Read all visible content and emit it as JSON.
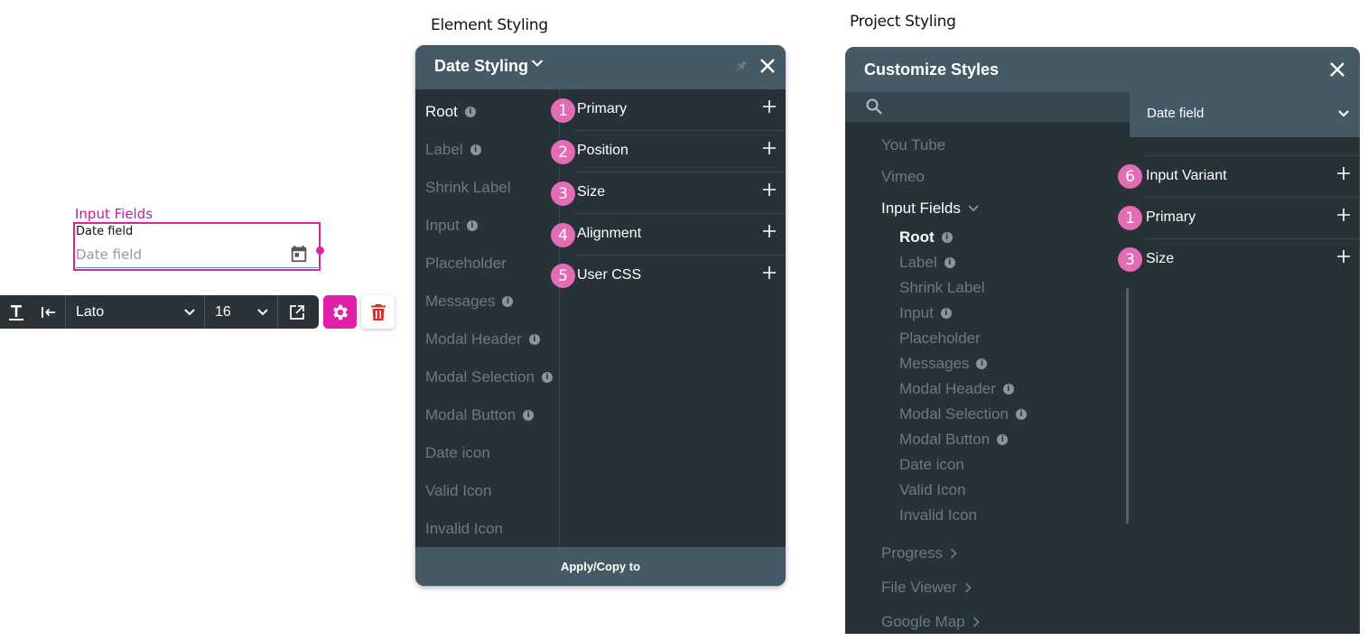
{
  "captions": {
    "element": "Element Styling",
    "project": "Project Styling"
  },
  "canvas": {
    "group_label": "Input Fields",
    "field_label": "Date field",
    "field_placeholder": "Date field"
  },
  "toolbar": {
    "font": "Lato",
    "size": "16"
  },
  "element_panel": {
    "title": "Date Styling",
    "left_items": [
      {
        "label": "Root",
        "info": "i",
        "active": true
      },
      {
        "label": "Label",
        "info": "i"
      },
      {
        "label": "Shrink Label"
      },
      {
        "label": "Input",
        "info": "i"
      },
      {
        "label": "Placeholder"
      },
      {
        "label": "Messages",
        "info": "i"
      },
      {
        "label": "Modal Header",
        "info": "i"
      },
      {
        "label": "Modal Selection",
        "info": "i"
      },
      {
        "label": "Modal Button",
        "info": "i"
      },
      {
        "label": "Date icon"
      },
      {
        "label": "Valid Icon"
      },
      {
        "label": "Invalid Icon"
      }
    ],
    "rows": [
      {
        "badge": "1",
        "label": "Primary"
      },
      {
        "badge": "2",
        "label": "Position"
      },
      {
        "badge": "3",
        "label": "Size"
      },
      {
        "badge": "4",
        "label": "Alignment"
      },
      {
        "badge": "5",
        "label": "User CSS"
      }
    ],
    "footer": "Apply/Copy to"
  },
  "project_panel": {
    "title": "Customize Styles",
    "selected": "Date field",
    "tree": {
      "youtube": "You Tube",
      "vimeo": "Vimeo",
      "input_fields": "Input Fields",
      "children": [
        {
          "label": "Root",
          "info": "i"
        },
        {
          "label": "Label",
          "info": "i"
        },
        {
          "label": "Shrink Label"
        },
        {
          "label": "Input",
          "info": "i"
        },
        {
          "label": "Placeholder"
        },
        {
          "label": "Messages",
          "info": "i"
        },
        {
          "label": "Modal Header",
          "info": "i"
        },
        {
          "label": "Modal Selection",
          "info": "i"
        },
        {
          "label": "Modal Button",
          "info": "i"
        },
        {
          "label": "Date icon"
        },
        {
          "label": "Valid Icon"
        },
        {
          "label": "Invalid Icon"
        }
      ],
      "progress": "Progress",
      "file_viewer": "File Viewer",
      "google_map": "Google Map"
    },
    "rows": [
      {
        "badge": "6",
        "label": "Input Variant"
      },
      {
        "badge": "1",
        "label": "Primary"
      },
      {
        "badge": "3",
        "label": "Size"
      }
    ]
  },
  "colors": {
    "accent": "#e020a8",
    "badge": "#e46cb4",
    "panel_bg": "#263238",
    "panel_header": "#455a64"
  },
  "icons": {
    "toolbar": [
      "text-style-icon",
      "align-left-icon",
      "chevron-down-icon",
      "open-external-icon",
      "gear-icon",
      "trash-icon"
    ],
    "panels": [
      "chevron-down-icon",
      "pin-icon",
      "close-icon",
      "plus-icon",
      "info-icon",
      "search-icon",
      "chevron-right-icon",
      "calendar-icon"
    ]
  }
}
